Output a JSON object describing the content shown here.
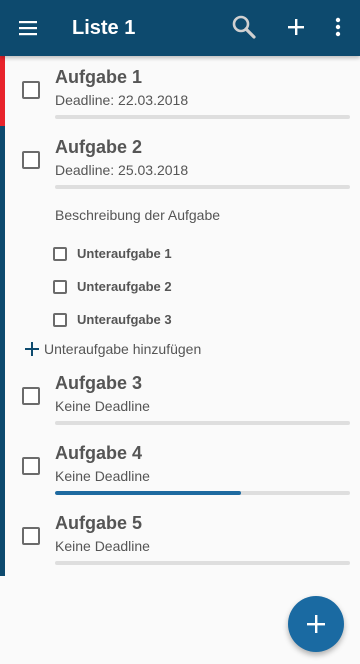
{
  "appbar": {
    "title": "Liste 1",
    "icons": {
      "menu": "menu-icon",
      "search": "search-icon",
      "add": "plus-icon",
      "more": "more-vert-icon"
    }
  },
  "colors": {
    "appbar_bg": "#0d4a6e",
    "stripe_red": "#e8232b",
    "stripe_blue": "#0d4a6e",
    "progress_fill": "#1e6aa0",
    "progress_track": "#dedede",
    "fab_bg": "#1a6aa2"
  },
  "tasks": [
    {
      "title": "Aufgabe 1",
      "deadline": "Deadline: 22.03.2018",
      "progress": 0,
      "checked": false,
      "stripe": "red"
    },
    {
      "title": "Aufgabe 2",
      "deadline": "Deadline: 25.03.2018",
      "progress": 0,
      "checked": false,
      "stripe": "blue",
      "expanded": true,
      "description": "Beschreibung der Aufgabe",
      "subtasks": [
        {
          "label": "Unteraufgabe 1",
          "checked": false
        },
        {
          "label": "Unteraufgabe 2",
          "checked": false
        },
        {
          "label": "Unteraufgabe 3",
          "checked": false
        }
      ],
      "add_subtask_label": "Unteraufgabe hinzufügen"
    },
    {
      "title": "Aufgabe 3",
      "deadline": "Keine Deadline",
      "progress": 0,
      "checked": false,
      "stripe": "blue"
    },
    {
      "title": "Aufgabe 4",
      "deadline": "Keine Deadline",
      "progress": 0.63,
      "checked": false,
      "stripe": "blue"
    },
    {
      "title": "Aufgabe 5",
      "deadline": "Keine Deadline",
      "progress": 0,
      "checked": false,
      "stripe": "blue"
    }
  ],
  "fab": {
    "icon": "plus-icon"
  }
}
